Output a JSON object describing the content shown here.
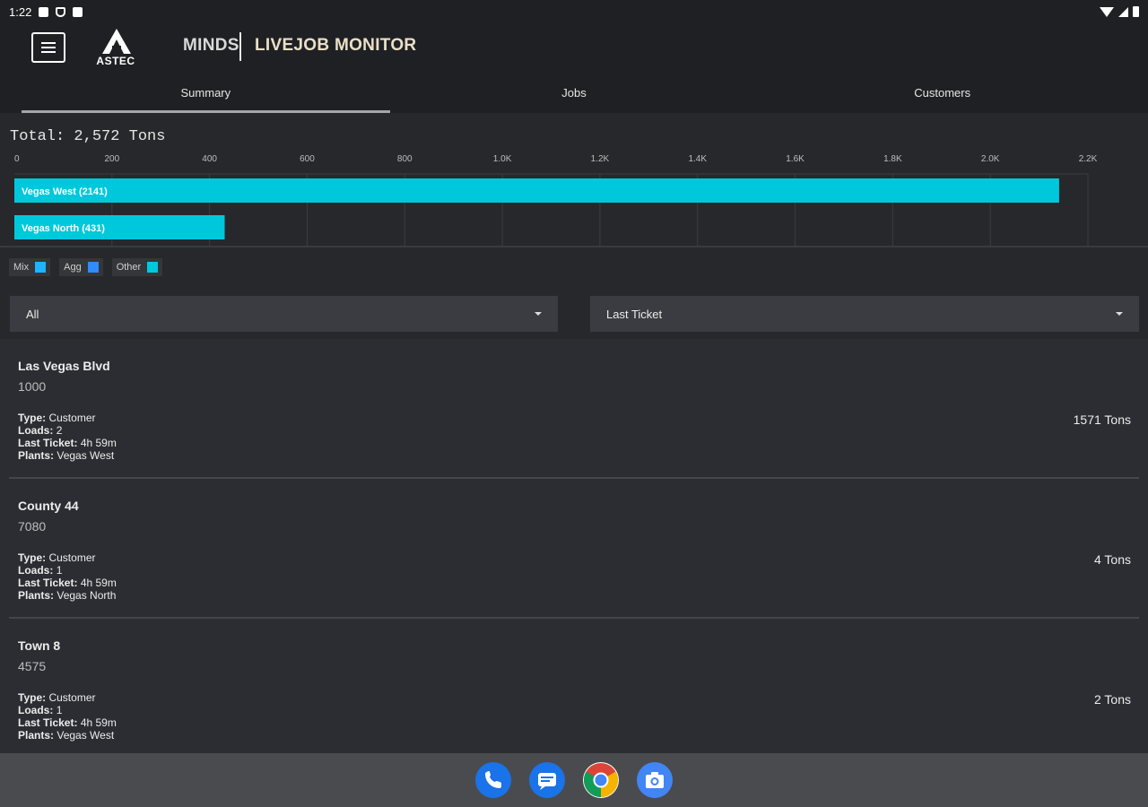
{
  "status_bar": {
    "time": "1:22"
  },
  "header": {
    "logo_text": "ASTEC",
    "app_name": "MINDS",
    "title": "LIVEJOB MONITOR",
    "tabs": [
      {
        "label": "Summary",
        "active": true
      },
      {
        "label": "Jobs",
        "active": false
      },
      {
        "label": "Customers",
        "active": false
      }
    ]
  },
  "summary": {
    "total_label": "Total: 2,572 Tons",
    "legend": [
      {
        "label": "Mix",
        "color": "#1fb4ff"
      },
      {
        "label": "Agg",
        "color": "#2f8bff"
      },
      {
        "label": "Other",
        "color": "#00c8dc"
      }
    ]
  },
  "chart_data": {
    "type": "bar",
    "orientation": "horizontal",
    "categories": [
      "Vegas West",
      "Vegas North"
    ],
    "bar_labels": [
      "Vegas West (2141)",
      "Vegas North (431)"
    ],
    "values": [
      2141,
      431
    ],
    "ticks": [
      "0",
      "200",
      "400",
      "600",
      "800",
      "1.0K",
      "1.2K",
      "1.4K",
      "1.6K",
      "1.8K",
      "2.0K",
      "2.2K"
    ],
    "xlim": [
      0,
      2200
    ],
    "bar_color": "#00c8dc",
    "grid": true
  },
  "filters": {
    "left_select": {
      "value": "All"
    },
    "right_select": {
      "value": "Last Ticket"
    }
  },
  "jobs": [
    {
      "name": "Las Vegas Blvd",
      "number": "1000",
      "type": "Customer",
      "loads": "2",
      "last_ticket": "4h 59m",
      "plants": "Vegas West",
      "tons": "1571 Tons"
    },
    {
      "name": "County 44",
      "number": "7080",
      "type": "Customer",
      "loads": "1",
      "last_ticket": "4h 59m",
      "plants": "Vegas North",
      "tons": "4 Tons"
    },
    {
      "name": "Town 8",
      "number": "4575",
      "type": "Customer",
      "loads": "1",
      "last_ticket": "4h 59m",
      "plants": "Vegas West",
      "tons": "2 Tons"
    }
  ],
  "labels": {
    "type": "Type:",
    "loads": "Loads:",
    "last_ticket": "Last Ticket:",
    "plants": "Plants:"
  },
  "dock": [
    {
      "icon": "phone-icon",
      "color": "#1a73e8"
    },
    {
      "icon": "messages-icon",
      "color": "#1a73e8"
    },
    {
      "icon": "chrome-icon",
      "color": "#ffffff"
    },
    {
      "icon": "camera-icon",
      "color": "#4285f4"
    }
  ]
}
